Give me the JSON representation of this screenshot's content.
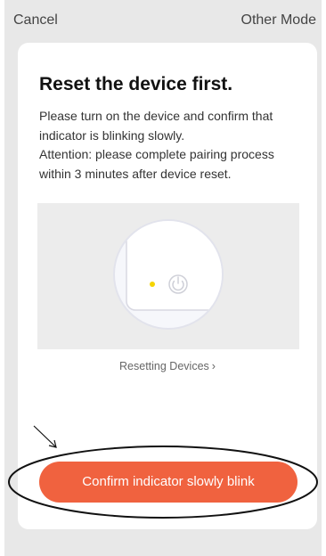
{
  "header": {
    "cancel_label": "Cancel",
    "other_mode_label": "Other Mode"
  },
  "card": {
    "title": "Reset the device first.",
    "instruction": "Please turn on the device and confirm that indicator is blinking slowly.",
    "attention": "Attention: please complete pairing process within 3 minutes after device reset.",
    "resetting_link": "Resetting Devices",
    "resetting_link_icon": "chevron-right-icon",
    "confirm_button": "Confirm indicator slowly blink"
  },
  "illustration": {
    "indicator_color": "#f5d400",
    "power_icon": "power-icon"
  },
  "colors": {
    "accent": "#f0623f",
    "background": "#e8e8e8",
    "card": "#ffffff"
  }
}
